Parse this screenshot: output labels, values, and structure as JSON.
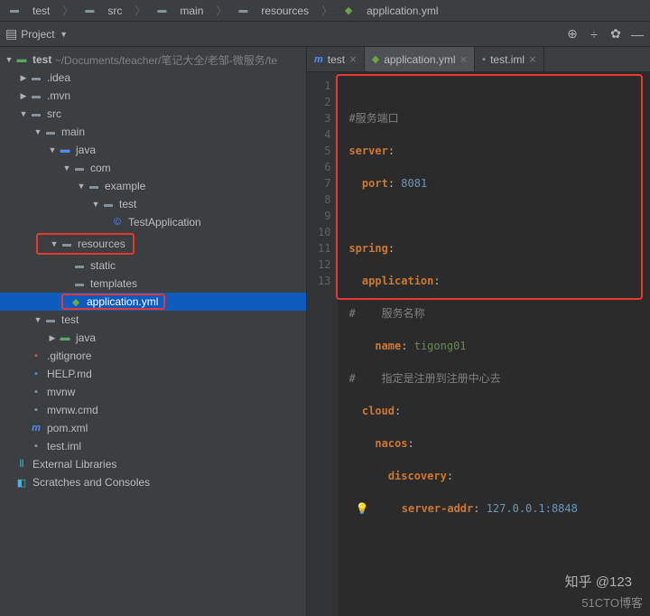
{
  "breadcrumb": {
    "items": [
      "test",
      "src",
      "main",
      "resources",
      "application.yml"
    ]
  },
  "project_label": "Project",
  "project_root": {
    "name": "test",
    "path": "~/Documents/teacher/笔记大全/老邹-微服务/te"
  },
  "tree": {
    "idea": ".idea",
    "mvn": ".mvn",
    "src": "src",
    "main": "main",
    "java": "java",
    "com": "com",
    "example": "example",
    "test": "test",
    "testApp": "TestApplication",
    "resources": "resources",
    "static": "static",
    "templates": "templates",
    "appyml": "application.yml",
    "test2": "test",
    "java2": "java",
    "gitignore": ".gitignore",
    "help": "HELP.md",
    "mvnw": "mvnw",
    "mvnwcmd": "mvnw.cmd",
    "pom": "pom.xml",
    "testiml": "test.iml",
    "extlib": "External Libraries",
    "scratches": "Scratches and Consoles"
  },
  "tabs": [
    {
      "label": "test"
    },
    {
      "label": "application.yml"
    },
    {
      "label": "test.iml"
    }
  ],
  "code": {
    "lines": [
      "1",
      "2",
      "3",
      "4",
      "5",
      "6",
      "7",
      "8",
      "9",
      "10",
      "11",
      "12",
      "13"
    ],
    "l1_cmt": "#服务端口",
    "l2_k": "server",
    "l2_c": ":",
    "l3_k": "port",
    "l3_c": ": ",
    "l3_v": "8081",
    "l5_k": "spring",
    "l5_c": ":",
    "l6_k": "application",
    "l6_c": ":",
    "l7_cmt": "#    服务名称",
    "l8_k": "name",
    "l8_c": ": ",
    "l8_v": "tigong01",
    "l9_cmt": "#    指定是注册到注册中心去",
    "l10_k": "cloud",
    "l10_c": ":",
    "l11_k": "nacos",
    "l11_c": ":",
    "l12_k": "discovery",
    "l12_c": ":",
    "l13_k": "server-addr",
    "l13_c": ": ",
    "l13_v": "127.0.0.1:8848"
  },
  "watermark1": "知乎 @123",
  "watermark2": "51CTO博客"
}
